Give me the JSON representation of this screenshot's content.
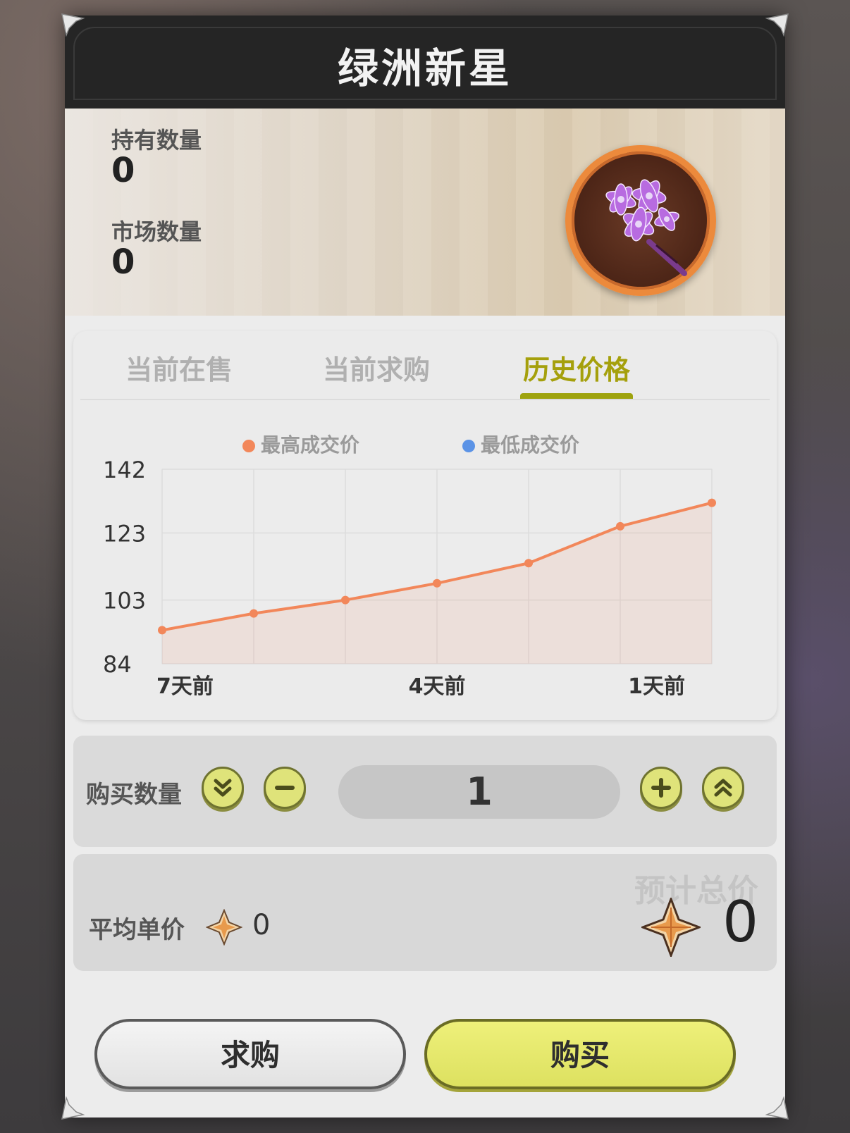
{
  "dialog": {
    "title": "绿洲新星"
  },
  "item": {
    "held_label": "持有数量",
    "held_value": "0",
    "market_label": "市场数量",
    "market_value": "0",
    "icon": "purple-flower-icon"
  },
  "tabs": [
    {
      "label": "当前在售",
      "active": false
    },
    {
      "label": "当前求购",
      "active": false
    },
    {
      "label": "历史价格",
      "active": true
    }
  ],
  "chart_data": {
    "type": "line",
    "legend": [
      {
        "name": "最高成交价",
        "color": "#f2875a"
      },
      {
        "name": "最低成交价",
        "color": "#5b93e6"
      }
    ],
    "x": [
      7,
      6,
      5,
      4,
      3,
      2,
      1
    ],
    "x_tick_labels": [
      "7天前",
      "4天前",
      "1天前"
    ],
    "y_tick_labels": [
      "142",
      "123",
      "103",
      "84"
    ],
    "ylim": [
      84,
      142
    ],
    "series": [
      {
        "name": "最高成交价",
        "color": "#f2875a",
        "values": [
          94,
          99,
          103,
          108,
          114,
          125,
          132
        ]
      }
    ],
    "grid": true
  },
  "purchase": {
    "qty_label": "购买数量",
    "qty_value": "1",
    "avg_label": "平均单价",
    "avg_value": "0",
    "total_label": "预计总价",
    "total_value": "0",
    "currency_icon": "crystal-star-icon"
  },
  "buttons": {
    "request_label": "求购",
    "buy_label": "购买"
  },
  "colors": {
    "accent": "#a5a00c",
    "button_yellow": "#dfe37a",
    "line_orange": "#f2875a"
  }
}
